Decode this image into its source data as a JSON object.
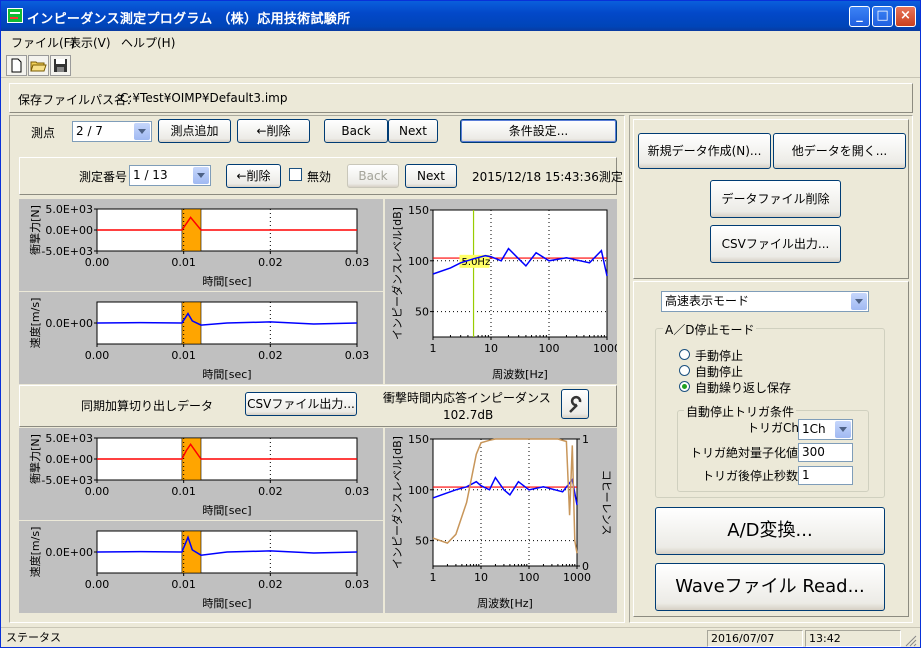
{
  "window": {
    "title": "インピーダンス測定プログラム （株）応用技術試験所",
    "min_glyph": "_",
    "max_glyph": "□",
    "close_glyph": "×"
  },
  "menu": [
    "ファイル(F)",
    "表示(V)",
    "ヘルプ(H)"
  ],
  "toolbar": {
    "icons": [
      "new-file-icon",
      "open-folder-icon",
      "save-disk-icon"
    ]
  },
  "file_path": {
    "label": "保存ファイルパス名：",
    "value": "C:¥Test¥OIMP¥Default3.imp"
  },
  "point_row": {
    "label": "測点",
    "combo_value": "2 / 7",
    "add": "測点追加",
    "delete": "←削除",
    "back": "Back",
    "next": "Next",
    "settings": "条件設定..."
  },
  "measure_row": {
    "label": "測定番号",
    "combo_value": "1 / 13",
    "delete": "←削除",
    "invalid_label": "無効",
    "back": "Back",
    "next": "Next",
    "timestamp": "2015/12/18 15:43:36測定"
  },
  "sync_row": {
    "label": "同期加算切り出しデータ",
    "csv_button": "CSVファイル出力...",
    "impedance_label": "衝撃時間内応答インピーダンス",
    "impedance_value": "102.7dB"
  },
  "right_panel": {
    "new_data": "新規データ作成(N)...",
    "open_other": "他データを開く...",
    "delete_file": "データファイル削除",
    "csv_out": "CSVファイル出力...",
    "display_mode": "高速表示モード",
    "ad_stop_title": "A／D停止モード",
    "radios": [
      {
        "label": "手動停止",
        "selected": false
      },
      {
        "label": "自動停止",
        "selected": false
      },
      {
        "label": "自動繰り返し保存",
        "selected": true
      }
    ],
    "trigger_title": "自動停止トリガ条件",
    "trigger_ch_label": "トリガCh",
    "trigger_ch_value": "1Ch",
    "trigger_abs_label": "トリガ絶対量子化値",
    "trigger_abs_value": "300",
    "trigger_sec_label": "トリガ後停止秒数",
    "trigger_sec_value": "1",
    "ad_button": "A/D変換...",
    "wave_button": "Waveファイル Read..."
  },
  "status": {
    "text": "ステータス",
    "date": "2016/07/07",
    "time": "13:42"
  },
  "colors": {
    "red_trace": "#ff0000",
    "blue_trace": "#0000ff",
    "brown_trace": "#c8965a",
    "highlight": "#ffa500",
    "green_marker": "#99cc00"
  },
  "chart_data": [
    {
      "type": "line",
      "id": "force-upper",
      "ylabel": "衝撃力[N]",
      "xlabel": "時間[sec]",
      "yticks": [
        "5.0E+03",
        "0.0E+00",
        "-5.0E+03"
      ],
      "ylim": [
        -5000,
        5000
      ],
      "xticks": [
        "0.00",
        "0.01",
        "0.02",
        "0.03"
      ],
      "xlim": [
        0,
        0.03
      ],
      "highlight_range": [
        0.0098,
        0.012
      ],
      "series": [
        {
          "color": "red",
          "x": [
            0,
            0.0098,
            0.0103,
            0.0108,
            0.012,
            0.03
          ],
          "y": [
            0,
            0,
            1500,
            3000,
            0,
            0
          ]
        }
      ]
    },
    {
      "type": "line",
      "id": "velocity-upper",
      "ylabel": "速度[m/s]",
      "xlabel": "時間[sec]",
      "yticks": [
        "0.0E+00"
      ],
      "ylim": [
        -1,
        1
      ],
      "xticks": [
        "0.00",
        "0.01",
        "0.02",
        "0.03"
      ],
      "xlim": [
        0,
        0.03
      ],
      "highlight_range": [
        0.0098,
        0.012
      ],
      "series": [
        {
          "color": "blue",
          "x": [
            0,
            0.005,
            0.0098,
            0.0105,
            0.011,
            0.012,
            0.015,
            0.02,
            0.025,
            0.03
          ],
          "y": [
            0,
            0.02,
            0,
            0.45,
            0.1,
            -0.1,
            0,
            0.05,
            -0.05,
            0
          ]
        }
      ]
    },
    {
      "type": "line",
      "id": "impedance-upper",
      "ylabel": "インピーダンスレベル[dB]",
      "xlabel": "周波数[Hz]",
      "xscale": "log",
      "yticks": [
        "150",
        "100",
        "50"
      ],
      "ylim": [
        25,
        150
      ],
      "xticks": [
        "1",
        "10",
        "100",
        "1000"
      ],
      "xlim": [
        1,
        1000
      ],
      "marker": {
        "x": 5.0,
        "label": "5.0Hz"
      },
      "reference_line": 102.7,
      "series": [
        {
          "color": "blue",
          "x": [
            1,
            2,
            3,
            5,
            8,
            10,
            15,
            20,
            30,
            40,
            60,
            100,
            200,
            500,
            800,
            1000
          ],
          "y": [
            87,
            93,
            98,
            102,
            105,
            104,
            100,
            112,
            102,
            95,
            108,
            100,
            103,
            98,
            110,
            85
          ]
        }
      ]
    },
    {
      "type": "line",
      "id": "force-lower",
      "ylabel": "衝撃力[N]",
      "xlabel": "時間[sec]",
      "yticks": [
        "5.0E+03",
        "0.0E+00",
        "-5.0E+03"
      ],
      "ylim": [
        -5000,
        5000
      ],
      "xticks": [
        "0.00",
        "0.01",
        "0.02",
        "0.03"
      ],
      "xlim": [
        0,
        0.03
      ],
      "highlight_range": [
        0.0098,
        0.012
      ],
      "series": [
        {
          "color": "red",
          "x": [
            0,
            0.0098,
            0.0103,
            0.0108,
            0.012,
            0.03
          ],
          "y": [
            0,
            0,
            2000,
            3500,
            0,
            0
          ]
        }
      ]
    },
    {
      "type": "line",
      "id": "velocity-lower",
      "ylabel": "速度[m/s]",
      "xlabel": "時間[sec]",
      "yticks": [
        "0.0E+00"
      ],
      "ylim": [
        -1,
        1
      ],
      "xticks": [
        "0.00",
        "0.01",
        "0.02",
        "0.03"
      ],
      "xlim": [
        0,
        0.03
      ],
      "highlight_range": [
        0.0098,
        0.012
      ],
      "series": [
        {
          "color": "blue",
          "x": [
            0,
            0.005,
            0.0098,
            0.0105,
            0.011,
            0.012,
            0.015,
            0.02,
            0.025,
            0.03
          ],
          "y": [
            0,
            0.02,
            0,
            0.7,
            0.1,
            -0.15,
            0,
            0.05,
            -0.05,
            0
          ]
        }
      ]
    },
    {
      "type": "line",
      "id": "impedance-coherence-lower",
      "ylabel": "インピーダンスレベル[dB]",
      "y2label": "コヒーレンス",
      "xlabel": "周波数[Hz]",
      "xscale": "log",
      "yticks": [
        "150",
        "100",
        "50"
      ],
      "ylim": [
        25,
        150
      ],
      "y2ticks": [
        "1",
        "0"
      ],
      "y2lim": [
        0,
        1
      ],
      "xticks": [
        "1",
        "10",
        "100",
        "1000"
      ],
      "xlim": [
        1,
        1000
      ],
      "reference_line": 102.7,
      "series": [
        {
          "color": "blue",
          "x": [
            1,
            2,
            3,
            5,
            8,
            10,
            15,
            20,
            30,
            40,
            60,
            100,
            200,
            500,
            800,
            1000
          ],
          "y": [
            92,
            97,
            100,
            103,
            108,
            104,
            100,
            112,
            100,
            95,
            108,
            100,
            103,
            98,
            110,
            85
          ]
        },
        {
          "color": "brown",
          "axis": "y2",
          "x": [
            1,
            2,
            3,
            5,
            8,
            10,
            15,
            20,
            30,
            50,
            100,
            200,
            400,
            600,
            700,
            800,
            900,
            1000
          ],
          "y": [
            0.22,
            0.18,
            0.25,
            0.5,
            0.88,
            0.97,
            0.99,
            1,
            1,
            1,
            1,
            1,
            1,
            0.98,
            0.4,
            0.95,
            0.2,
            0.1
          ]
        }
      ]
    }
  ]
}
